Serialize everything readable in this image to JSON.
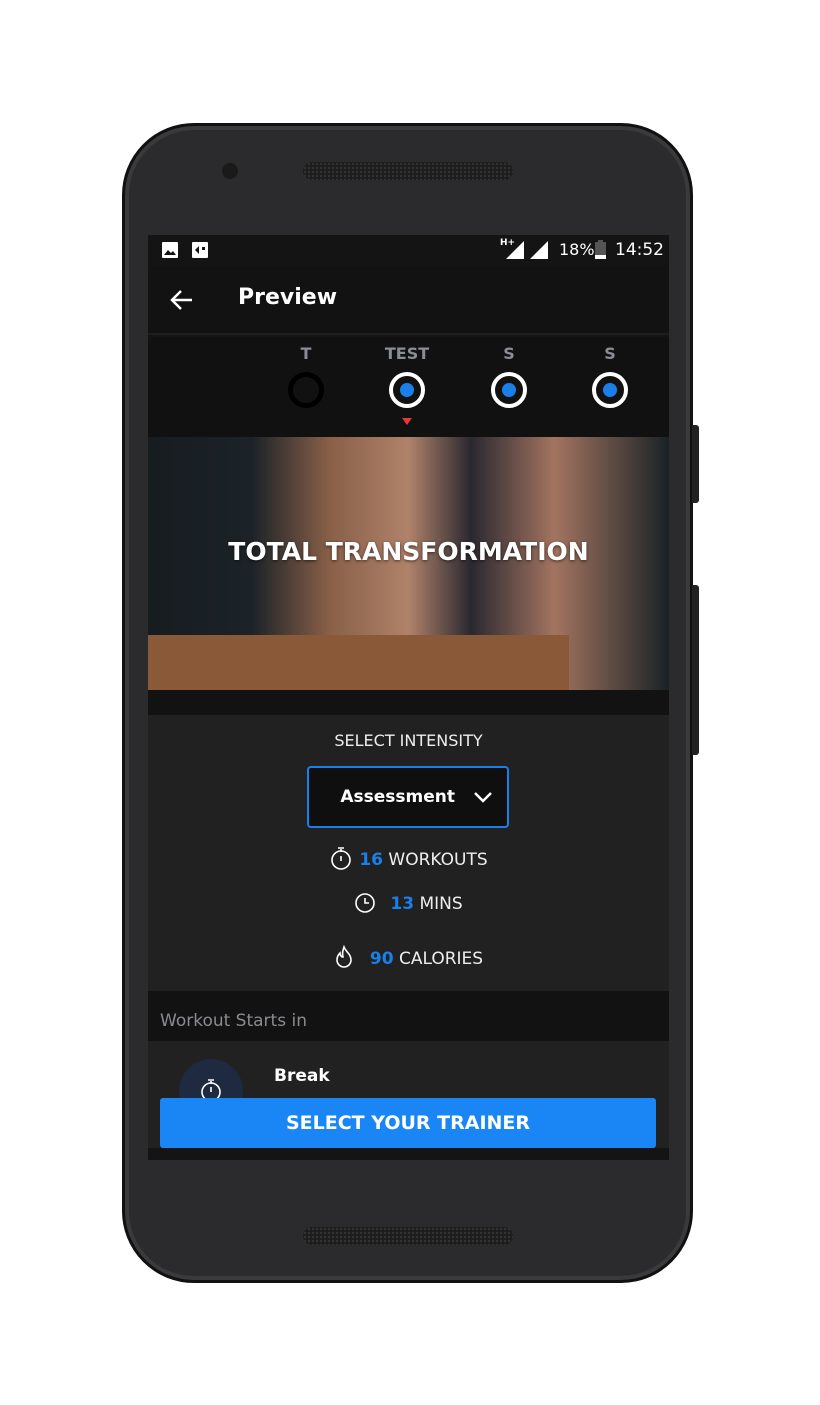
{
  "status_bar": {
    "network": "H+",
    "battery": "18%",
    "time": "14:52"
  },
  "app_bar": {
    "title": "Preview"
  },
  "steps": [
    {
      "label": "T",
      "active": false
    },
    {
      "label": "TEST",
      "active": true,
      "selected": true
    },
    {
      "label": "S",
      "active": true
    },
    {
      "label": "S",
      "active": true
    }
  ],
  "hero": {
    "title": "TOTAL TRANSFORMATION"
  },
  "intensity": {
    "label": "SELECT INTENSITY",
    "selected": "Assessment"
  },
  "stats": {
    "workouts": {
      "value": "16",
      "unit": "WORKOUTS"
    },
    "mins": {
      "value": "13",
      "unit": "MINS"
    },
    "calories": {
      "value": "90",
      "unit": "CALORIES"
    }
  },
  "section": {
    "title": "Workout Starts in"
  },
  "list": [
    {
      "title": "Break",
      "icon": "stopwatch-icon"
    }
  ],
  "cta": {
    "label": "SELECT YOUR TRAINER"
  },
  "colors": {
    "accent": "#1a86f5",
    "indicator": "#e53935",
    "background": "#212121"
  }
}
